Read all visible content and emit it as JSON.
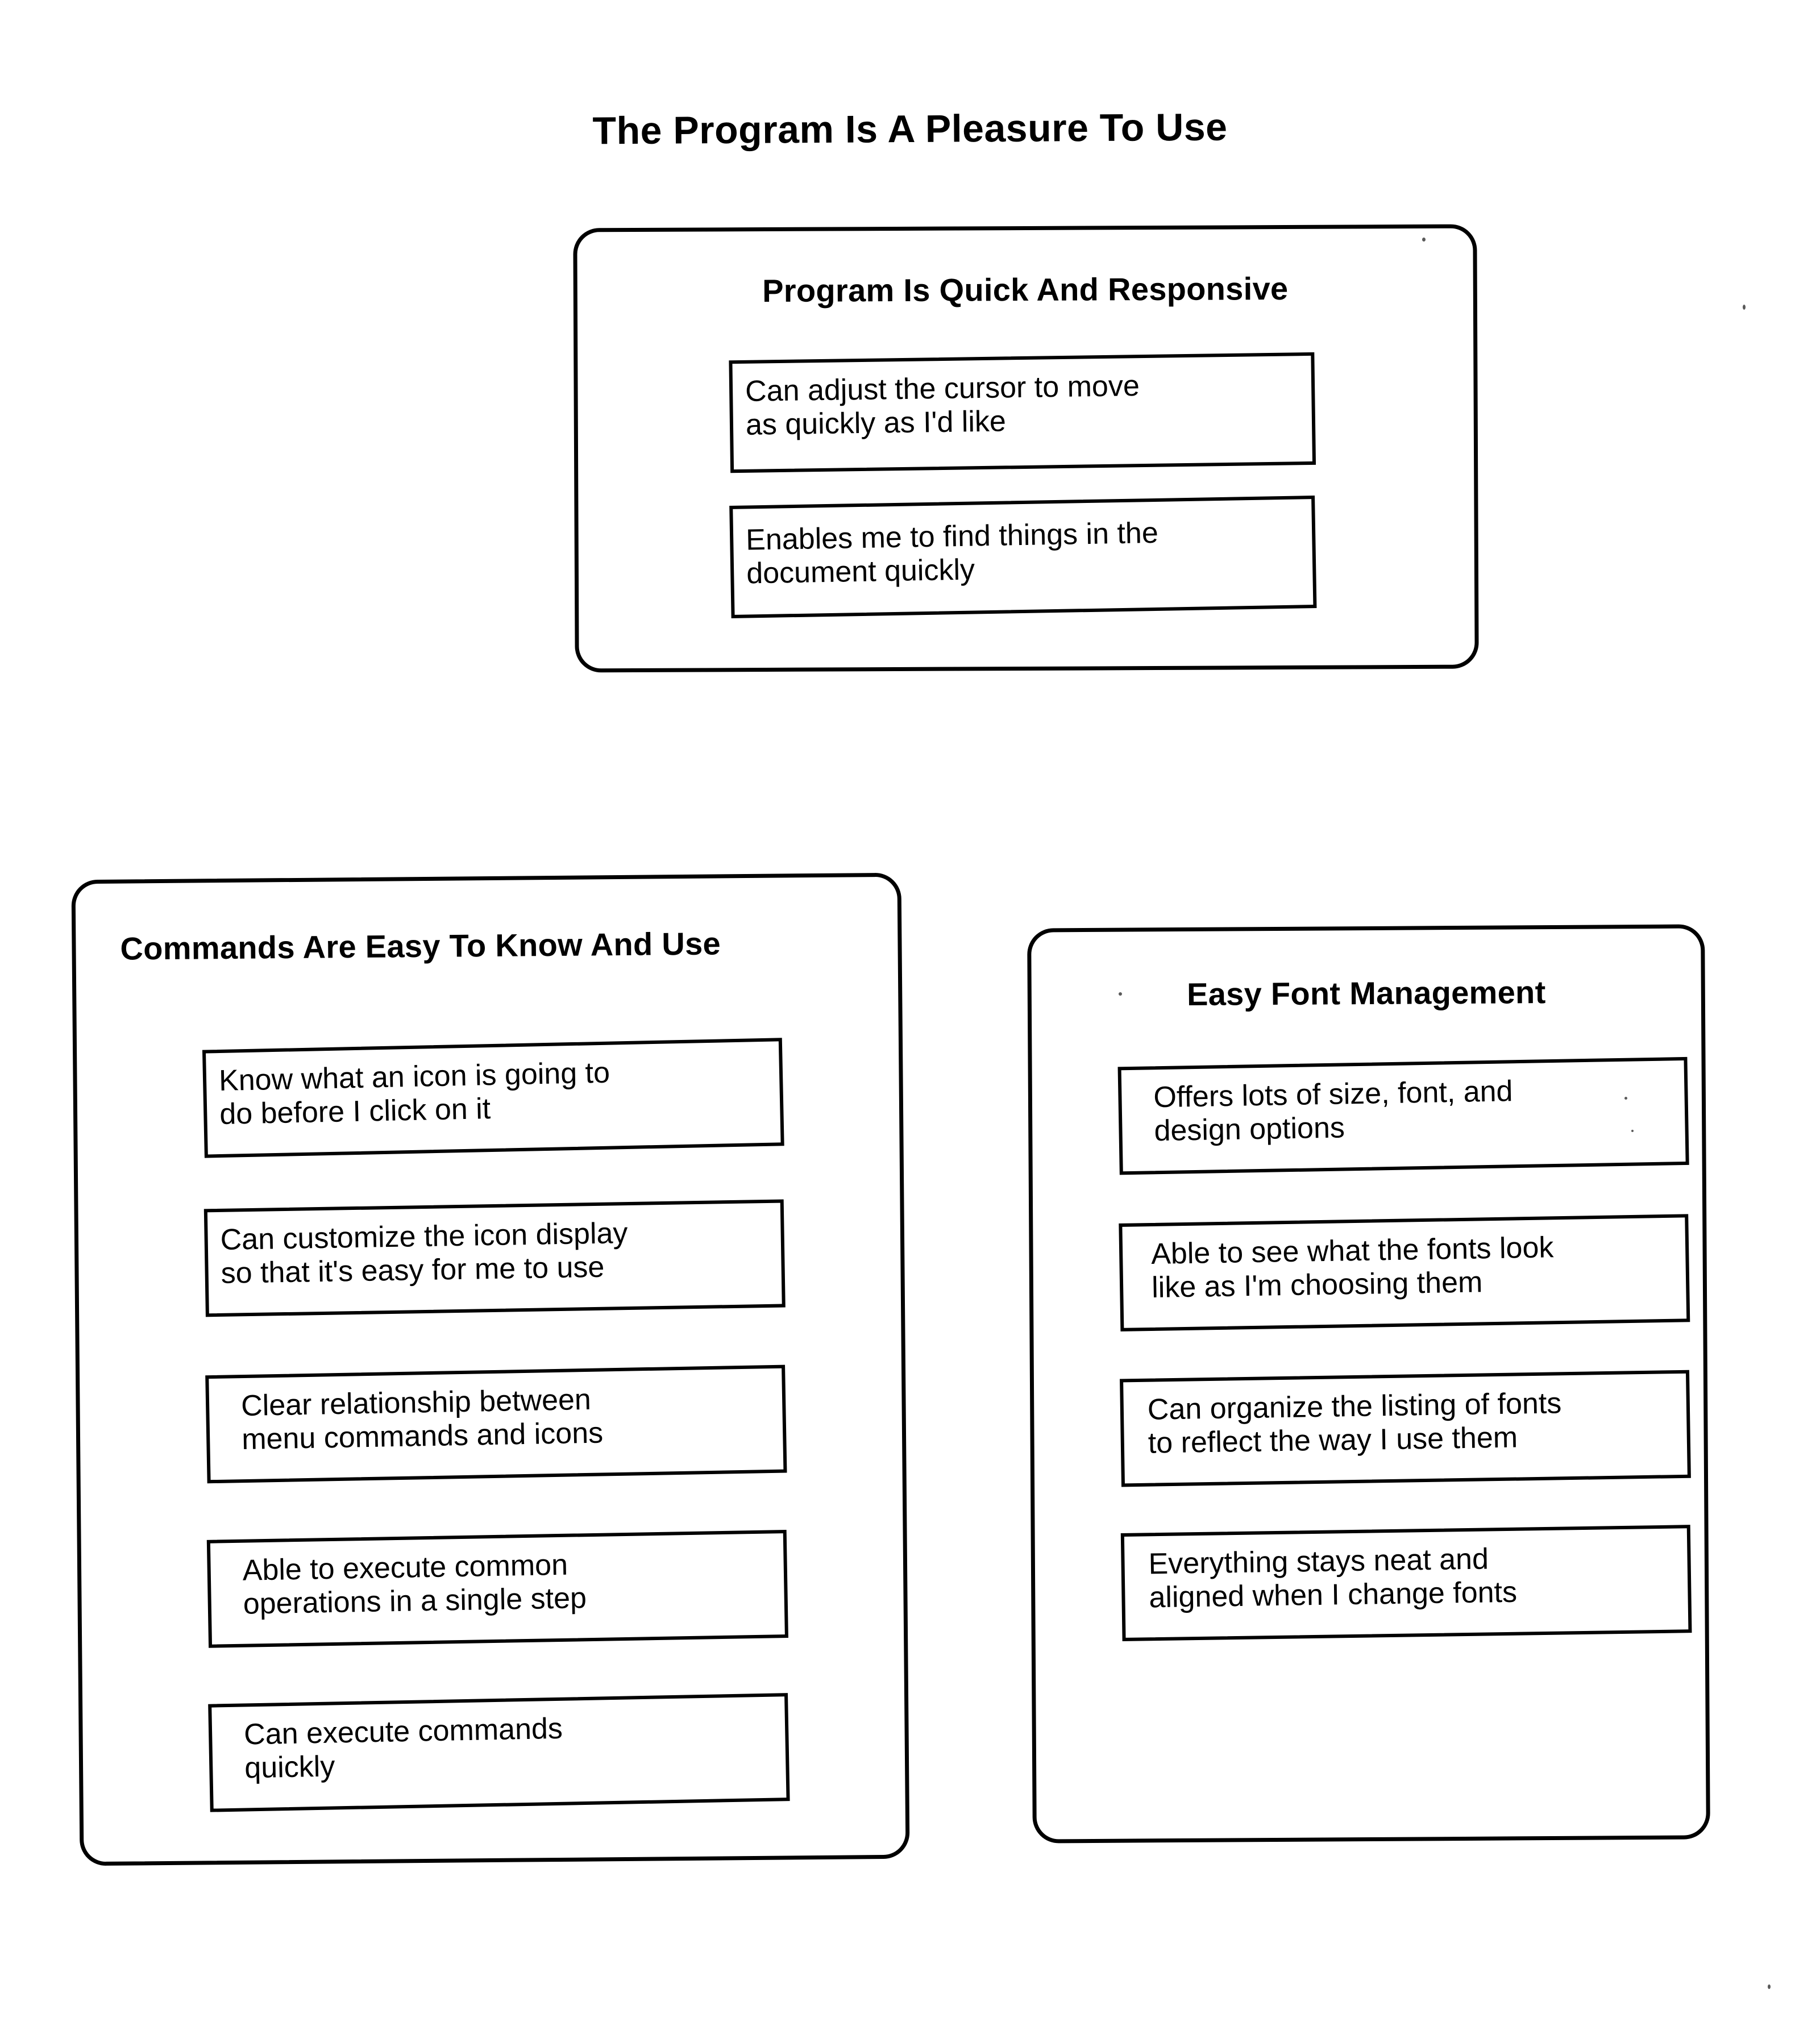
{
  "page": {
    "title": "The Program Is A Pleasure To Use"
  },
  "groups": [
    {
      "id": "responsive",
      "title": "Program Is Quick And Responsive",
      "items": [
        {
          "line1": "Can adjust the cursor to move",
          "line2": "as quickly as I'd like"
        },
        {
          "line1": "Enables me to find things in the",
          "line2": "document quickly"
        }
      ]
    },
    {
      "id": "commands",
      "title": "Commands Are Easy To Know And Use",
      "items": [
        {
          "line1": "Know what an icon is going to",
          "line2": "do before I click on it"
        },
        {
          "line1": "Can customize the icon display",
          "line2": "so that it's easy for me to use"
        },
        {
          "line1": "Clear relationship between",
          "line2": "menu commands and icons"
        },
        {
          "line1": "Able to execute common",
          "line2": "operations in a single step"
        },
        {
          "line1": "Can execute commands",
          "line2": "quickly"
        }
      ]
    },
    {
      "id": "fonts",
      "title": "Easy Font Management",
      "items": [
        {
          "line1": "Offers lots of size, font, and",
          "line2": "design options"
        },
        {
          "line1": "Able to see what the fonts look",
          "line2": "like as I'm choosing them"
        },
        {
          "line1": "Can organize the listing of fonts",
          "line2": "to reflect the way I use them"
        },
        {
          "line1": "Everything stays neat and",
          "line2": "aligned when I change fonts"
        }
      ]
    }
  ],
  "colors": {
    "ink": "#000000",
    "paper": "#ffffff"
  }
}
